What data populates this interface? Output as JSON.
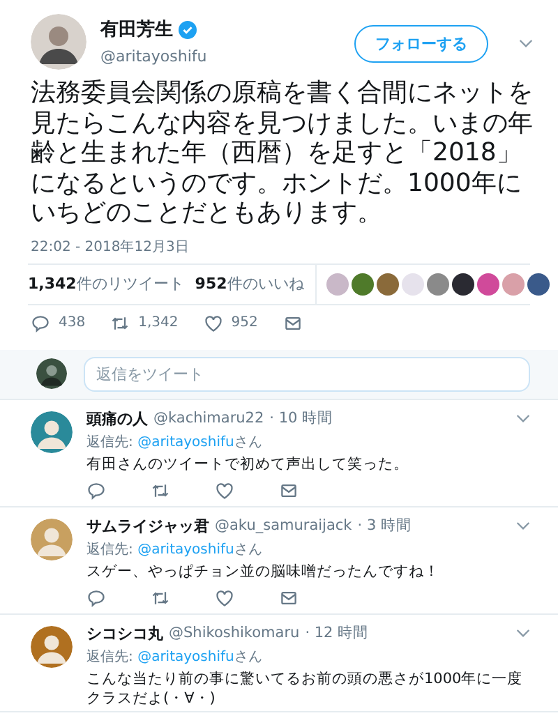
{
  "tweet": {
    "author": {
      "name": "有田芳生",
      "handle": "@aritayoshifu",
      "verified": true
    },
    "follow_button": "フォローする",
    "text": "法務委員会関係の原稿を書く合間にネットを見たらこんな内容を見つけました。いまの年齢と生まれた年（西暦）を足すと「2018」になるというのです。ホントだ。1000年にいちどのことだともあります。",
    "timestamp": "22:02 - 2018年12月3日",
    "retweets": {
      "count": "1,342",
      "label": "件のリツイート"
    },
    "likes": {
      "count": "952",
      "label": "件のいいね"
    },
    "liker_avatars": [
      {
        "color": "#c9b8c8"
      },
      {
        "color": "#4f7a2a"
      },
      {
        "color": "#8a6a3a"
      },
      {
        "color": "#e6e2ec"
      },
      {
        "color": "#8a8a8a"
      },
      {
        "color": "#2a2a32"
      },
      {
        "color": "#d04a9a"
      },
      {
        "color": "#d9a0a8"
      },
      {
        "color": "#3a5a8a"
      }
    ],
    "actions": {
      "replies": "438",
      "retweets": "1,342",
      "likes": "952"
    }
  },
  "reply_box": {
    "placeholder": "返信をツイート"
  },
  "replies": [
    {
      "name": "頭痛の人",
      "handle": "@kachimaru22",
      "time": "· 10 時間",
      "reply_to_label": "返信先:",
      "reply_to": "@aritayoshifu",
      "reply_suffix": "さん",
      "text": "有田さんのツイートで初めて声出して笑った。"
    },
    {
      "name": "サムライジャッ君",
      "handle": "@aku_samuraijack",
      "time": "· 3 時間",
      "reply_to_label": "返信先:",
      "reply_to": "@aritayoshifu",
      "reply_suffix": "さん",
      "text": "スゲー、やっぱチョン並の脳味噌だったんですね！"
    },
    {
      "name": "シコシコ丸",
      "handle": "@Shikoshikomaru",
      "time": "· 12 時間",
      "reply_to_label": "返信先:",
      "reply_to": "@aritayoshifu",
      "reply_suffix": "さん",
      "text": "こんな当たり前の事に驚いてるお前の頭の悪さが1000年に一度クラスだよ(・∀・)"
    }
  ]
}
